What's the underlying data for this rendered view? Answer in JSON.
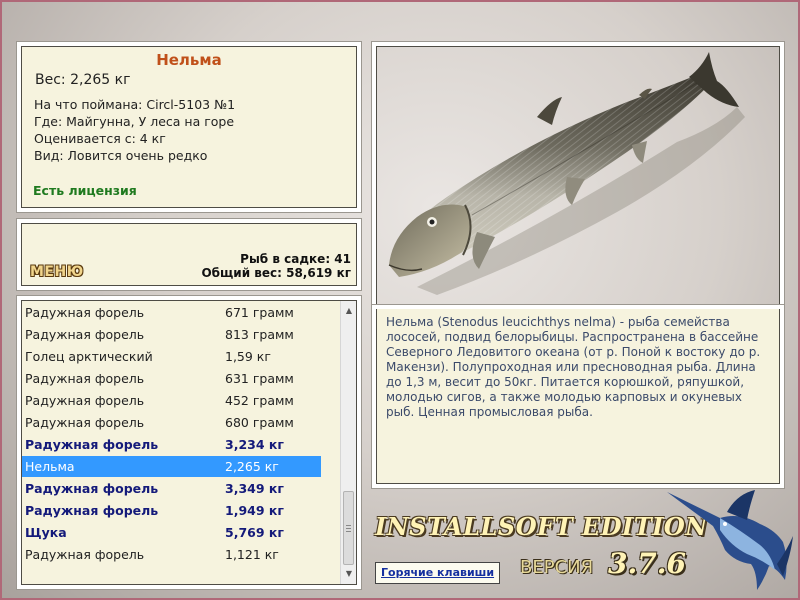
{
  "catch_info": {
    "title": "Нельма",
    "weight": "Вес: 2,265 кг",
    "bait": "На что поймана: Circl-5103 №1",
    "place": "Где: Майгунна, У леса на горе",
    "rated": "Оценивается с: 4 кг",
    "rarity": "Вид: Ловится очень редко",
    "license": "Есть лицензия"
  },
  "stats": {
    "menu_label": "МЕНЮ",
    "fish_in_cage": "Рыб в садке: 41",
    "total_weight": "Общий вес: 58,619 кг"
  },
  "catch_list": [
    {
      "name": "Радужная форель",
      "weight": "671 грамм",
      "bold": false,
      "selected": false
    },
    {
      "name": "Радужная форель",
      "weight": "813 грамм",
      "bold": false,
      "selected": false
    },
    {
      "name": "Голец арктический",
      "weight": "1,59 кг",
      "bold": false,
      "selected": false
    },
    {
      "name": "Радужная форель",
      "weight": "631 грамм",
      "bold": false,
      "selected": false
    },
    {
      "name": "Радужная форель",
      "weight": "452 грамм",
      "bold": false,
      "selected": false
    },
    {
      "name": "Радужная форель",
      "weight": "680 грамм",
      "bold": false,
      "selected": false
    },
    {
      "name": "Радужная форель",
      "weight": "3,234 кг",
      "bold": true,
      "selected": false
    },
    {
      "name": "Нельма",
      "weight": "2,265 кг",
      "bold": false,
      "selected": true
    },
    {
      "name": "Радужная форель",
      "weight": "3,349 кг",
      "bold": true,
      "selected": false
    },
    {
      "name": "Радужная форель",
      "weight": "1,949 кг",
      "bold": true,
      "selected": false
    },
    {
      "name": "Щука",
      "weight": "5,769 кг",
      "bold": true,
      "selected": false
    },
    {
      "name": "Радужная форель",
      "weight": "1,121 кг",
      "bold": false,
      "selected": false
    }
  ],
  "description": "Нельма (Stenodus leucichthys nelma) - рыба семейства лососей, подвид белорыбицы. Распространена в бассейне Северного Ледовитого океана (от р. Поной к востоку до р. Макензи). Полупроходная или пресноводная рыба. Длина до 1,3 м, весит до 50кг. Питается корюшкой, ряпушкой, молодью сигов, а также молодью карповых и окуневых рыб. Ценная промысловая рыба.",
  "branding": {
    "edition": "INSTALLSOFT EDITION",
    "version_label": "ВЕРСИЯ",
    "version_number": "3.7.6"
  },
  "hotkeys_label": "Горячие клавиши",
  "icons": {
    "fish_photo": "nelma-fish-image",
    "logo": "marlin-icon",
    "scroll_up": "scroll-up-arrow-icon",
    "scroll_down": "scroll-down-arrow-icon"
  },
  "colors": {
    "title": "#c0501a",
    "license": "#1f7a1f",
    "selection": "#3399ff",
    "bold_row": "#141a7a",
    "description": "#3b4a6a"
  }
}
